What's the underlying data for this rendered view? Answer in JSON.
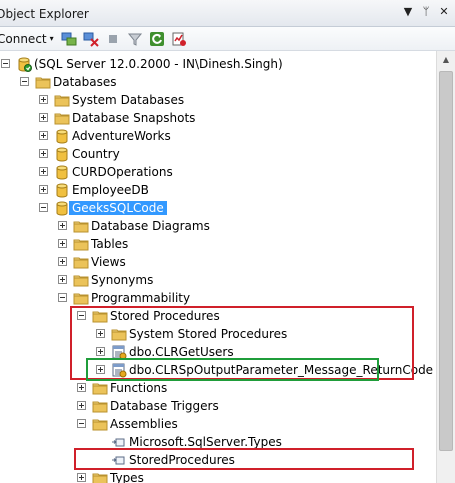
{
  "window": {
    "title": "Object Explorer",
    "ctrl_dropdown": "▼",
    "ctrl_pin": "ᛘ",
    "ctrl_close": "✕"
  },
  "toolbar": {
    "connect_label": "Connect",
    "connect_caret": "▾"
  },
  "tree": [
    {
      "label": "(SQL Server 12.0.2000 - IN\\Dinesh.Singh)",
      "level": 0,
      "expander": "minus",
      "icon": "server-icon"
    },
    {
      "label": "Databases",
      "level": 1,
      "expander": "minus",
      "icon": "folder-icon"
    },
    {
      "label": "System Databases",
      "level": 2,
      "expander": "plus",
      "icon": "folder-icon"
    },
    {
      "label": "Database Snapshots",
      "level": 2,
      "expander": "plus",
      "icon": "folder-icon"
    },
    {
      "label": "AdventureWorks",
      "level": 2,
      "expander": "plus",
      "icon": "database-icon"
    },
    {
      "label": "Country",
      "level": 2,
      "expander": "plus",
      "icon": "database-icon"
    },
    {
      "label": "CURDOperations",
      "level": 2,
      "expander": "plus",
      "icon": "database-icon"
    },
    {
      "label": "EmployeeDB",
      "level": 2,
      "expander": "plus",
      "icon": "database-icon"
    },
    {
      "label": "GeeksSQLCode",
      "level": 2,
      "expander": "minus",
      "icon": "database-icon",
      "selected": true
    },
    {
      "label": "Database Diagrams",
      "level": 3,
      "expander": "plus",
      "icon": "folder-icon"
    },
    {
      "label": "Tables",
      "level": 3,
      "expander": "plus",
      "icon": "folder-icon"
    },
    {
      "label": "Views",
      "level": 3,
      "expander": "plus",
      "icon": "folder-icon"
    },
    {
      "label": "Synonyms",
      "level": 3,
      "expander": "plus",
      "icon": "folder-icon"
    },
    {
      "label": "Programmability",
      "level": 3,
      "expander": "minus",
      "icon": "folder-icon"
    },
    {
      "label": "Stored Procedures",
      "level": 4,
      "expander": "minus",
      "icon": "folder-icon"
    },
    {
      "label": "System Stored Procedures",
      "level": 5,
      "expander": "plus",
      "icon": "folder-icon"
    },
    {
      "label": "dbo.CLRGetUsers",
      "level": 5,
      "expander": "plus",
      "icon": "stored-procedure-icon"
    },
    {
      "label": "dbo.CLRSpOutputParameter_Message_ReturnCode",
      "level": 5,
      "expander": "plus",
      "icon": "stored-procedure-icon"
    },
    {
      "label": "Functions",
      "level": 4,
      "expander": "plus",
      "icon": "folder-icon"
    },
    {
      "label": "Database Triggers",
      "level": 4,
      "expander": "plus",
      "icon": "folder-icon"
    },
    {
      "label": "Assemblies",
      "level": 4,
      "expander": "minus",
      "icon": "folder-icon"
    },
    {
      "label": "Microsoft.SqlServer.Types",
      "level": 5,
      "expander": "none",
      "icon": "assembly-icon"
    },
    {
      "label": "StoredProcedures",
      "level": 5,
      "expander": "none",
      "icon": "assembly-icon"
    },
    {
      "label": "Types",
      "level": 4,
      "expander": "plus",
      "icon": "folder-icon"
    }
  ],
  "colors": {
    "selection": "#3399ff",
    "highlight_red": "#d0202a",
    "highlight_green": "#1f9d3a",
    "folder": "#e8c25a"
  }
}
